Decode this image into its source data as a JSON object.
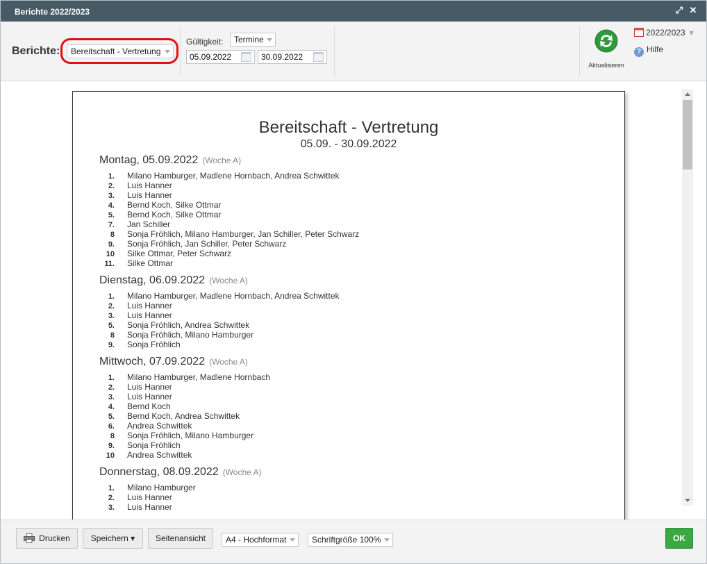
{
  "window": {
    "title": "Berichte 2022/2023",
    "maximize_icon": "expand-icon",
    "close_icon": "close-icon"
  },
  "toolbar": {
    "berichte_label": "Berichte:",
    "report_select": "Bereitschaft - Vertretung",
    "gueltigkeit_label": "Gültigkeit:",
    "gueltigkeit_select": "Termine",
    "date_from": "05.09.2022",
    "date_to": "30.09.2022",
    "refresh_label": "Aktualisieren",
    "year_select": "2022/2023",
    "help_label": "Hilfe"
  },
  "report": {
    "title": "Bereitschaft - Vertretung",
    "subtitle": "05.09. - 30.09.2022",
    "days": [
      {
        "heading": "Montag, 05.09.2022",
        "week": "(Woche A)",
        "rows": [
          {
            "num": "1.",
            "names": "Milano Hamburger, Madlene Hornbach, Andrea Schwittek"
          },
          {
            "num": "2.",
            "names": "Luis Hanner"
          },
          {
            "num": "3.",
            "names": "Luis Hanner"
          },
          {
            "num": "4.",
            "names": "Bernd Koch, Silke Ottmar"
          },
          {
            "num": "5.",
            "names": "Bernd Koch, Silke Ottmar"
          },
          {
            "num": "7.",
            "names": "Jan Schiller"
          },
          {
            "num": "8",
            "names": "Sonja Fröhlich, Milano Hamburger, Jan Schiller, Peter Schwarz"
          },
          {
            "num": "9.",
            "names": "Sonja Fröhlich, Jan Schiller, Peter Schwarz"
          },
          {
            "num": "10",
            "names": "Silke Ottmar, Peter Schwarz"
          },
          {
            "num": "11.",
            "names": "Silke Ottmar"
          }
        ]
      },
      {
        "heading": "Dienstag, 06.09.2022",
        "week": "(Woche A)",
        "rows": [
          {
            "num": "1.",
            "names": "Milano Hamburger, Madlene Hornbach, Andrea Schwittek"
          },
          {
            "num": "2.",
            "names": "Luis Hanner"
          },
          {
            "num": "3.",
            "names": "Luis Hanner"
          },
          {
            "num": "5.",
            "names": "Sonja Fröhlich, Andrea Schwittek"
          },
          {
            "num": "8",
            "names": "Sonja Fröhlich, Milano Hamburger"
          },
          {
            "num": "9.",
            "names": "Sonja Fröhlich"
          }
        ]
      },
      {
        "heading": "Mittwoch, 07.09.2022",
        "week": "(Woche A)",
        "rows": [
          {
            "num": "1.",
            "names": "Milano Hamburger, Madlene Hornbach"
          },
          {
            "num": "2.",
            "names": "Luis Hanner"
          },
          {
            "num": "3.",
            "names": "Luis Hanner"
          },
          {
            "num": "4.",
            "names": "Bernd Koch"
          },
          {
            "num": "5.",
            "names": "Bernd Koch, Andrea Schwittek"
          },
          {
            "num": "6.",
            "names": "Andrea Schwittek"
          },
          {
            "num": "8",
            "names": "Sonja Fröhlich, Milano Hamburger"
          },
          {
            "num": "9.",
            "names": "Sonja Fröhlich"
          },
          {
            "num": "10",
            "names": "Andrea Schwittek"
          }
        ]
      },
      {
        "heading": "Donnerstag, 08.09.2022",
        "week": "(Woche A)",
        "rows": [
          {
            "num": "1.",
            "names": "Milano Hamburger"
          },
          {
            "num": "2.",
            "names": "Luis Hanner"
          },
          {
            "num": "3.",
            "names": "Luis Hanner"
          }
        ]
      }
    ]
  },
  "footer": {
    "print_label": "Drucken",
    "save_label": "Speichern ▾",
    "page_view_label": "Seitenansicht",
    "format_select": "A4 - Hochformat",
    "font_size_select": "Schriftgröße 100%",
    "ok_label": "OK"
  },
  "colors": {
    "titlebar": "#475b66",
    "highlight": "#e01010",
    "ok_button": "#3aa944"
  }
}
